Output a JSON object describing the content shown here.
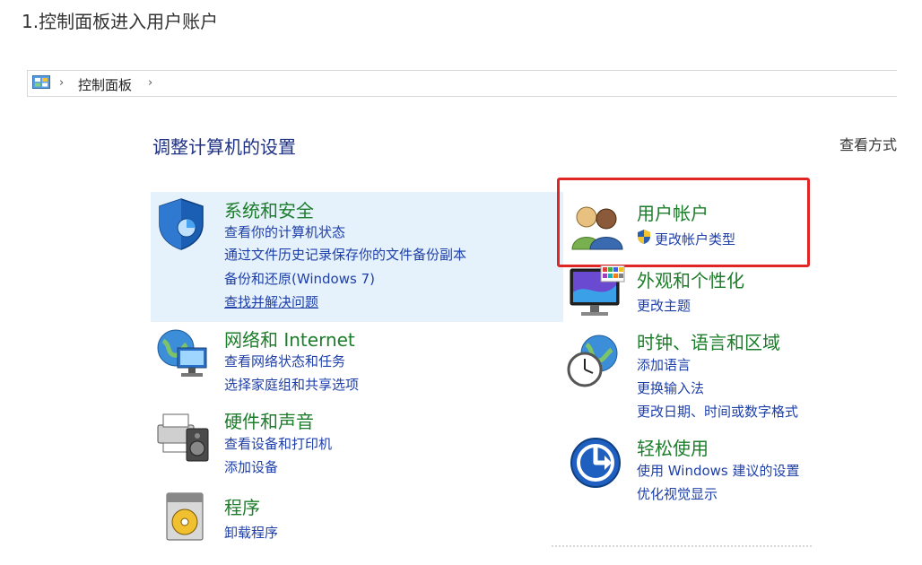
{
  "caption": "1.控制面板进入用户账户",
  "addressbar": {
    "crumb": "控制面板",
    "separator": "›"
  },
  "page_title": "调整计算机的设置",
  "view_by": "查看方式",
  "categories": {
    "system": {
      "title": "系统和安全",
      "links": [
        "查看你的计算机状态",
        "通过文件历史记录保存你的文件备份副本",
        "备份和还原(Windows 7)",
        "查找并解决问题"
      ]
    },
    "network": {
      "title": "网络和 Internet",
      "links": [
        "查看网络状态和任务",
        "选择家庭组和共享选项"
      ]
    },
    "hardware": {
      "title": "硬件和声音",
      "links": [
        "查看设备和打印机",
        "添加设备"
      ]
    },
    "programs": {
      "title": "程序",
      "links": [
        "卸载程序"
      ]
    },
    "users": {
      "title": "用户帐户",
      "links": [
        "更改帐户类型"
      ]
    },
    "appearance": {
      "title": "外观和个性化",
      "links": [
        "更改主题"
      ]
    },
    "clock": {
      "title": "时钟、语言和区域",
      "links": [
        "添加语言",
        "更换输入法",
        "更改日期、时间或数字格式"
      ]
    },
    "ease": {
      "title": "轻松使用",
      "links": [
        "使用 Windows 建议的设置",
        "优化视觉显示"
      ]
    }
  },
  "colors": {
    "title_green": "#1c7d2a",
    "link_blue": "#1e3fa8",
    "heading_blue": "#1e3287",
    "highlight_bg": "#e5f1fb",
    "annotation_red": "#e02525"
  }
}
